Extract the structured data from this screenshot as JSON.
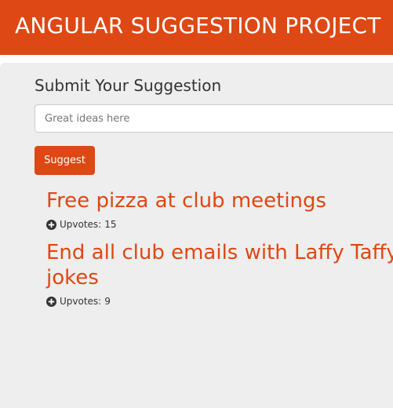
{
  "header": {
    "title": "ANGULAR SUGGESTION PROJECT",
    "background_color": "#dd4814"
  },
  "form": {
    "heading": "Submit Your Suggestion",
    "input_placeholder": "Great ideas here",
    "input_value": "",
    "button_label": "Suggest"
  },
  "suggestions": [
    {
      "title": "Free pizza at club meetings",
      "upvotes_label": "Upvotes:",
      "upvotes": "15"
    },
    {
      "title": "End all club emails with Laffy Taffy\njokes",
      "upvotes_label": "Upvotes:",
      "upvotes": "9"
    }
  ],
  "icons": {
    "upvote": "plus-circle-icon"
  },
  "colors": {
    "accent": "#dd4814",
    "panel": "#eeeeee"
  }
}
